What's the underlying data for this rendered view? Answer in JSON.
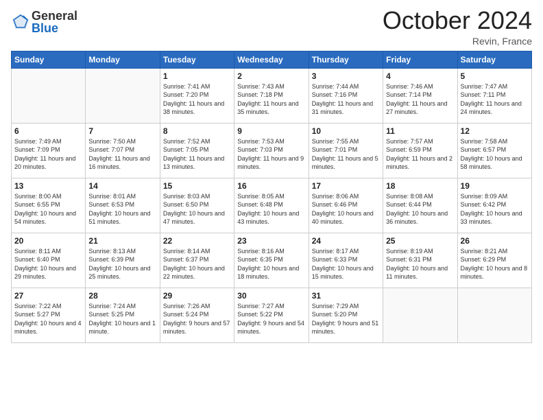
{
  "header": {
    "logo_general": "General",
    "logo_blue": "Blue",
    "month": "October 2024",
    "location": "Revin, France"
  },
  "weekdays": [
    "Sunday",
    "Monday",
    "Tuesday",
    "Wednesday",
    "Thursday",
    "Friday",
    "Saturday"
  ],
  "weeks": [
    [
      {
        "day": null
      },
      {
        "day": null
      },
      {
        "day": "1",
        "sunrise": "Sunrise: 7:41 AM",
        "sunset": "Sunset: 7:20 PM",
        "daylight": "Daylight: 11 hours and 38 minutes."
      },
      {
        "day": "2",
        "sunrise": "Sunrise: 7:43 AM",
        "sunset": "Sunset: 7:18 PM",
        "daylight": "Daylight: 11 hours and 35 minutes."
      },
      {
        "day": "3",
        "sunrise": "Sunrise: 7:44 AM",
        "sunset": "Sunset: 7:16 PM",
        "daylight": "Daylight: 11 hours and 31 minutes."
      },
      {
        "day": "4",
        "sunrise": "Sunrise: 7:46 AM",
        "sunset": "Sunset: 7:14 PM",
        "daylight": "Daylight: 11 hours and 27 minutes."
      },
      {
        "day": "5",
        "sunrise": "Sunrise: 7:47 AM",
        "sunset": "Sunset: 7:11 PM",
        "daylight": "Daylight: 11 hours and 24 minutes."
      }
    ],
    [
      {
        "day": "6",
        "sunrise": "Sunrise: 7:49 AM",
        "sunset": "Sunset: 7:09 PM",
        "daylight": "Daylight: 11 hours and 20 minutes."
      },
      {
        "day": "7",
        "sunrise": "Sunrise: 7:50 AM",
        "sunset": "Sunset: 7:07 PM",
        "daylight": "Daylight: 11 hours and 16 minutes."
      },
      {
        "day": "8",
        "sunrise": "Sunrise: 7:52 AM",
        "sunset": "Sunset: 7:05 PM",
        "daylight": "Daylight: 11 hours and 13 minutes."
      },
      {
        "day": "9",
        "sunrise": "Sunrise: 7:53 AM",
        "sunset": "Sunset: 7:03 PM",
        "daylight": "Daylight: 11 hours and 9 minutes."
      },
      {
        "day": "10",
        "sunrise": "Sunrise: 7:55 AM",
        "sunset": "Sunset: 7:01 PM",
        "daylight": "Daylight: 11 hours and 5 minutes."
      },
      {
        "day": "11",
        "sunrise": "Sunrise: 7:57 AM",
        "sunset": "Sunset: 6:59 PM",
        "daylight": "Daylight: 11 hours and 2 minutes."
      },
      {
        "day": "12",
        "sunrise": "Sunrise: 7:58 AM",
        "sunset": "Sunset: 6:57 PM",
        "daylight": "Daylight: 10 hours and 58 minutes."
      }
    ],
    [
      {
        "day": "13",
        "sunrise": "Sunrise: 8:00 AM",
        "sunset": "Sunset: 6:55 PM",
        "daylight": "Daylight: 10 hours and 54 minutes."
      },
      {
        "day": "14",
        "sunrise": "Sunrise: 8:01 AM",
        "sunset": "Sunset: 6:53 PM",
        "daylight": "Daylight: 10 hours and 51 minutes."
      },
      {
        "day": "15",
        "sunrise": "Sunrise: 8:03 AM",
        "sunset": "Sunset: 6:50 PM",
        "daylight": "Daylight: 10 hours and 47 minutes."
      },
      {
        "day": "16",
        "sunrise": "Sunrise: 8:05 AM",
        "sunset": "Sunset: 6:48 PM",
        "daylight": "Daylight: 10 hours and 43 minutes."
      },
      {
        "day": "17",
        "sunrise": "Sunrise: 8:06 AM",
        "sunset": "Sunset: 6:46 PM",
        "daylight": "Daylight: 10 hours and 40 minutes."
      },
      {
        "day": "18",
        "sunrise": "Sunrise: 8:08 AM",
        "sunset": "Sunset: 6:44 PM",
        "daylight": "Daylight: 10 hours and 36 minutes."
      },
      {
        "day": "19",
        "sunrise": "Sunrise: 8:09 AM",
        "sunset": "Sunset: 6:42 PM",
        "daylight": "Daylight: 10 hours and 33 minutes."
      }
    ],
    [
      {
        "day": "20",
        "sunrise": "Sunrise: 8:11 AM",
        "sunset": "Sunset: 6:40 PM",
        "daylight": "Daylight: 10 hours and 29 minutes."
      },
      {
        "day": "21",
        "sunrise": "Sunrise: 8:13 AM",
        "sunset": "Sunset: 6:39 PM",
        "daylight": "Daylight: 10 hours and 25 minutes."
      },
      {
        "day": "22",
        "sunrise": "Sunrise: 8:14 AM",
        "sunset": "Sunset: 6:37 PM",
        "daylight": "Daylight: 10 hours and 22 minutes."
      },
      {
        "day": "23",
        "sunrise": "Sunrise: 8:16 AM",
        "sunset": "Sunset: 6:35 PM",
        "daylight": "Daylight: 10 hours and 18 minutes."
      },
      {
        "day": "24",
        "sunrise": "Sunrise: 8:17 AM",
        "sunset": "Sunset: 6:33 PM",
        "daylight": "Daylight: 10 hours and 15 minutes."
      },
      {
        "day": "25",
        "sunrise": "Sunrise: 8:19 AM",
        "sunset": "Sunset: 6:31 PM",
        "daylight": "Daylight: 10 hours and 11 minutes."
      },
      {
        "day": "26",
        "sunrise": "Sunrise: 8:21 AM",
        "sunset": "Sunset: 6:29 PM",
        "daylight": "Daylight: 10 hours and 8 minutes."
      }
    ],
    [
      {
        "day": "27",
        "sunrise": "Sunrise: 7:22 AM",
        "sunset": "Sunset: 5:27 PM",
        "daylight": "Daylight: 10 hours and 4 minutes."
      },
      {
        "day": "28",
        "sunrise": "Sunrise: 7:24 AM",
        "sunset": "Sunset: 5:25 PM",
        "daylight": "Daylight: 10 hours and 1 minute."
      },
      {
        "day": "29",
        "sunrise": "Sunrise: 7:26 AM",
        "sunset": "Sunset: 5:24 PM",
        "daylight": "Daylight: 9 hours and 57 minutes."
      },
      {
        "day": "30",
        "sunrise": "Sunrise: 7:27 AM",
        "sunset": "Sunset: 5:22 PM",
        "daylight": "Daylight: 9 hours and 54 minutes."
      },
      {
        "day": "31",
        "sunrise": "Sunrise: 7:29 AM",
        "sunset": "Sunset: 5:20 PM",
        "daylight": "Daylight: 9 hours and 51 minutes."
      },
      {
        "day": null
      },
      {
        "day": null
      }
    ]
  ]
}
